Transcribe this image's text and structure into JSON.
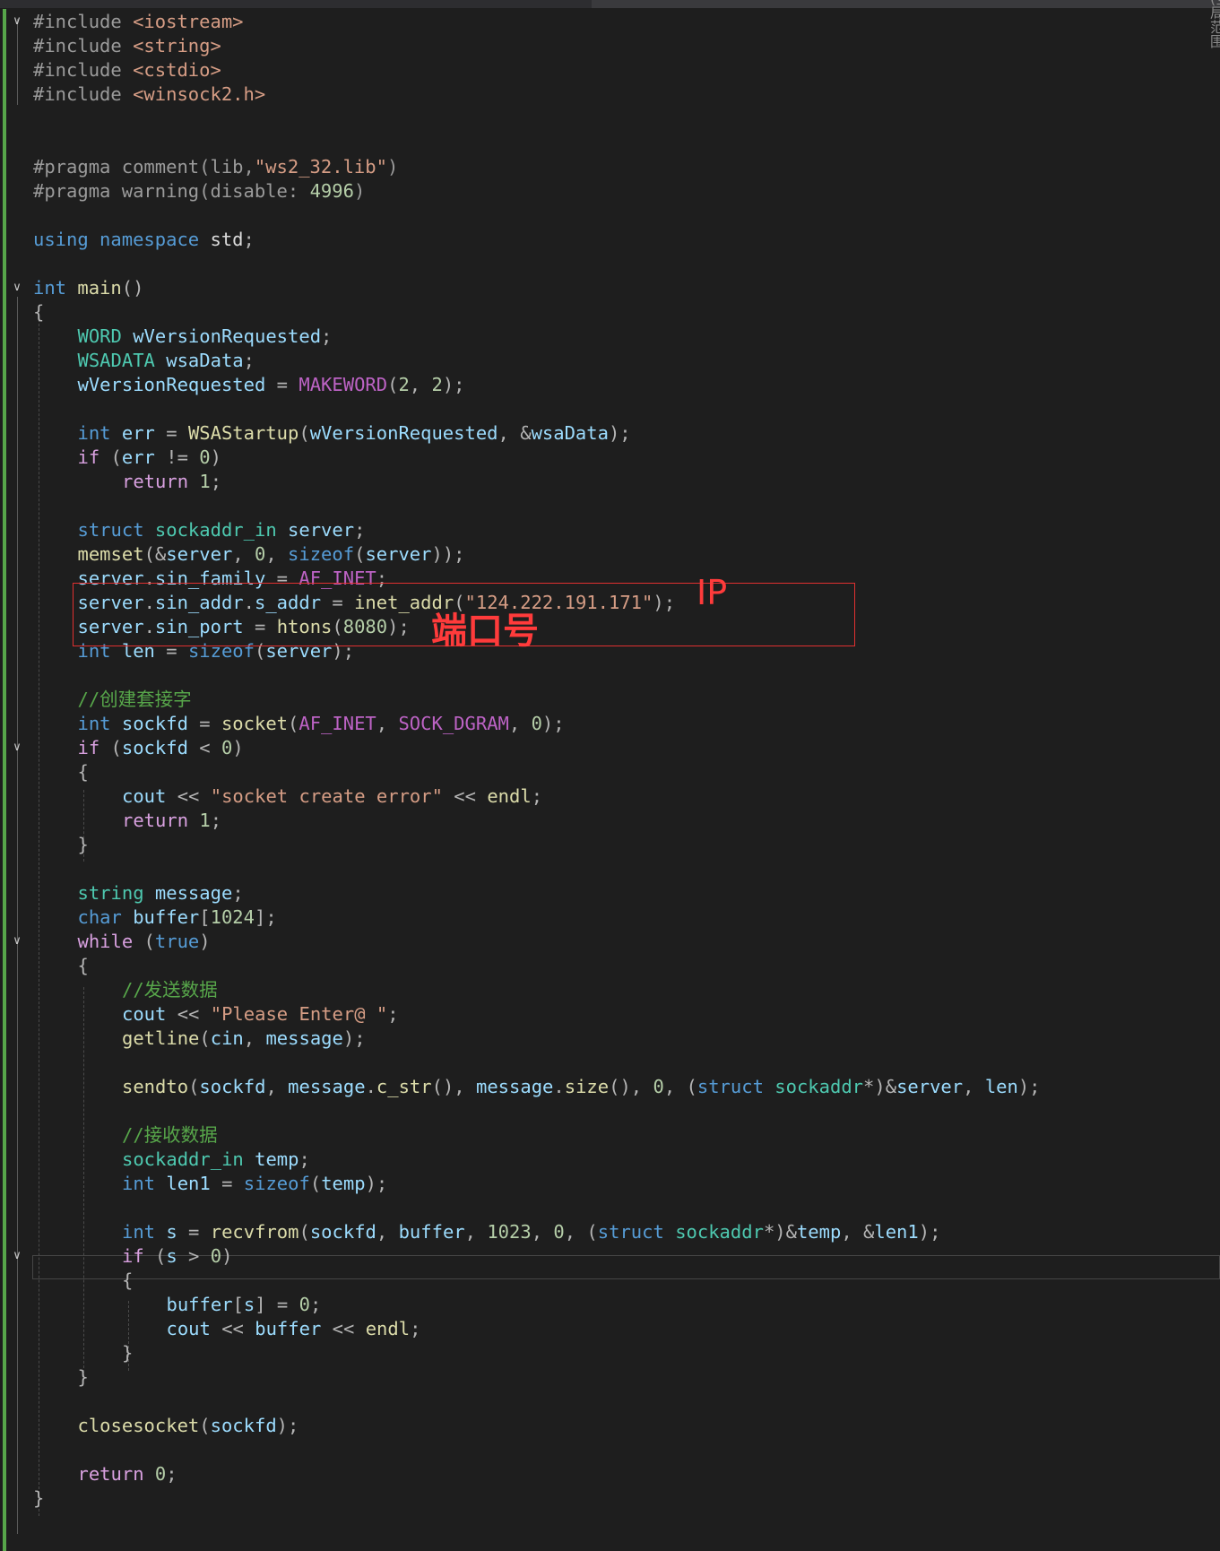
{
  "tab": {
    "title": "(全局范围)"
  },
  "annotations": {
    "ip_label": "IP",
    "port_label": "端口号"
  },
  "lines": [
    {
      "row": 0,
      "indent": 0,
      "fold": "v",
      "tokens": [
        [
          "pp",
          "#include "
        ],
        [
          "inc",
          "<iostream>"
        ]
      ]
    },
    {
      "row": 1,
      "indent": 0,
      "tokens": [
        [
          "pp",
          "#include "
        ],
        [
          "inc",
          "<string>"
        ]
      ]
    },
    {
      "row": 2,
      "indent": 0,
      "tokens": [
        [
          "pp",
          "#include "
        ],
        [
          "inc",
          "<cstdio>"
        ]
      ]
    },
    {
      "row": 3,
      "indent": 0,
      "tokens": [
        [
          "pp",
          "#include "
        ],
        [
          "inc",
          "<winsock2.h>"
        ]
      ]
    },
    {
      "row": 6,
      "indent": 0,
      "tokens": [
        [
          "pp",
          "#pragma comment(lib,"
        ],
        [
          "str",
          "\"ws2_32.lib\""
        ],
        [
          "pp",
          ")"
        ]
      ]
    },
    {
      "row": 7,
      "indent": 0,
      "tokens": [
        [
          "pp",
          "#pragma warning(disable: "
        ],
        [
          "num",
          "4996"
        ],
        [
          "pp",
          ")"
        ]
      ]
    },
    {
      "row": 9,
      "indent": 0,
      "tokens": [
        [
          "kw",
          "using namespace"
        ],
        [
          "",
          " std"
        ],
        [
          "pun",
          ";"
        ]
      ]
    },
    {
      "row": 11,
      "indent": 0,
      "fold": "v",
      "tokens": [
        [
          "kw",
          "int"
        ],
        [
          "",
          " "
        ],
        [
          "fn",
          "main"
        ],
        [
          "pun",
          "()"
        ]
      ]
    },
    {
      "row": 12,
      "indent": 0,
      "tokens": [
        [
          "pun",
          "{"
        ]
      ]
    },
    {
      "row": 13,
      "indent": 1,
      "tokens": [
        [
          "ty",
          "WORD"
        ],
        [
          "",
          " "
        ],
        [
          "var",
          "wVersionRequested"
        ],
        [
          "pun",
          ";"
        ]
      ]
    },
    {
      "row": 14,
      "indent": 1,
      "tokens": [
        [
          "ty",
          "WSADATA"
        ],
        [
          "",
          " "
        ],
        [
          "var",
          "wsaData"
        ],
        [
          "pun",
          ";"
        ]
      ]
    },
    {
      "row": 15,
      "indent": 1,
      "tokens": [
        [
          "var",
          "wVersionRequested"
        ],
        [
          "pun",
          " = "
        ],
        [
          "mac",
          "MAKEWORD"
        ],
        [
          "pun",
          "("
        ],
        [
          "num",
          "2"
        ],
        [
          "pun",
          ", "
        ],
        [
          "num",
          "2"
        ],
        [
          "pun",
          ");"
        ]
      ]
    },
    {
      "row": 17,
      "indent": 1,
      "tokens": [
        [
          "kw",
          "int"
        ],
        [
          "",
          " "
        ],
        [
          "var",
          "err"
        ],
        [
          "pun",
          " = "
        ],
        [
          "fn",
          "WSAStartup"
        ],
        [
          "pun",
          "("
        ],
        [
          "var",
          "wVersionRequested"
        ],
        [
          "pun",
          ", &"
        ],
        [
          "var",
          "wsaData"
        ],
        [
          "pun",
          ");"
        ]
      ]
    },
    {
      "row": 18,
      "indent": 1,
      "tokens": [
        [
          "ctl",
          "if"
        ],
        [
          "pun",
          " ("
        ],
        [
          "var",
          "err"
        ],
        [
          "pun",
          " != "
        ],
        [
          "num",
          "0"
        ],
        [
          "pun",
          ")"
        ]
      ]
    },
    {
      "row": 19,
      "indent": 2,
      "tokens": [
        [
          "ctl",
          "return"
        ],
        [
          "",
          " "
        ],
        [
          "num",
          "1"
        ],
        [
          "pun",
          ";"
        ]
      ]
    },
    {
      "row": 21,
      "indent": 1,
      "tokens": [
        [
          "kw",
          "struct"
        ],
        [
          "",
          " "
        ],
        [
          "ty",
          "sockaddr_in"
        ],
        [
          "",
          " "
        ],
        [
          "var",
          "server"
        ],
        [
          "pun",
          ";"
        ]
      ]
    },
    {
      "row": 22,
      "indent": 1,
      "tokens": [
        [
          "fn",
          "memset"
        ],
        [
          "pun",
          "(&"
        ],
        [
          "var",
          "server"
        ],
        [
          "pun",
          ", "
        ],
        [
          "num",
          "0"
        ],
        [
          "pun",
          ", "
        ],
        [
          "kw",
          "sizeof"
        ],
        [
          "pun",
          "("
        ],
        [
          "var",
          "server"
        ],
        [
          "pun",
          "));"
        ]
      ]
    },
    {
      "row": 23,
      "indent": 1,
      "tokens": [
        [
          "var",
          "server"
        ],
        [
          "pun",
          "."
        ],
        [
          "var",
          "sin_family"
        ],
        [
          "pun",
          " = "
        ],
        [
          "mac",
          "AF_INET"
        ],
        [
          "pun",
          ";"
        ]
      ]
    },
    {
      "row": 24,
      "indent": 1,
      "tokens": [
        [
          "var",
          "server"
        ],
        [
          "pun",
          "."
        ],
        [
          "var",
          "sin_addr"
        ],
        [
          "pun",
          "."
        ],
        [
          "var",
          "s_addr"
        ],
        [
          "pun",
          " = "
        ],
        [
          "fn",
          "inet_addr"
        ],
        [
          "pun",
          "("
        ],
        [
          "str",
          "\"124.222.191.171\""
        ],
        [
          "pun",
          ");"
        ]
      ]
    },
    {
      "row": 25,
      "indent": 1,
      "tokens": [
        [
          "var",
          "server"
        ],
        [
          "pun",
          "."
        ],
        [
          "var",
          "sin_port"
        ],
        [
          "pun",
          " = "
        ],
        [
          "fn",
          "htons"
        ],
        [
          "pun",
          "("
        ],
        [
          "num",
          "8080"
        ],
        [
          "pun",
          ");"
        ]
      ]
    },
    {
      "row": 26,
      "indent": 1,
      "tokens": [
        [
          "kw",
          "int"
        ],
        [
          "",
          " "
        ],
        [
          "var",
          "len"
        ],
        [
          "pun",
          " = "
        ],
        [
          "kw",
          "sizeof"
        ],
        [
          "pun",
          "("
        ],
        [
          "var",
          "server"
        ],
        [
          "pun",
          ");"
        ]
      ]
    },
    {
      "row": 28,
      "indent": 1,
      "tokens": [
        [
          "cmt",
          "//创建套接字"
        ]
      ]
    },
    {
      "row": 29,
      "indent": 1,
      "tokens": [
        [
          "kw",
          "int"
        ],
        [
          "",
          " "
        ],
        [
          "var",
          "sockfd"
        ],
        [
          "pun",
          " = "
        ],
        [
          "fn",
          "socket"
        ],
        [
          "pun",
          "("
        ],
        [
          "mac",
          "AF_INET"
        ],
        [
          "pun",
          ", "
        ],
        [
          "mac",
          "SOCK_DGRAM"
        ],
        [
          "pun",
          ", "
        ],
        [
          "num",
          "0"
        ],
        [
          "pun",
          ");"
        ]
      ]
    },
    {
      "row": 30,
      "indent": 1,
      "fold": "v",
      "tokens": [
        [
          "ctl",
          "if"
        ],
        [
          "pun",
          " ("
        ],
        [
          "var",
          "sockfd"
        ],
        [
          "pun",
          " < "
        ],
        [
          "num",
          "0"
        ],
        [
          "pun",
          ")"
        ]
      ]
    },
    {
      "row": 31,
      "indent": 1,
      "tokens": [
        [
          "pun",
          "{"
        ]
      ]
    },
    {
      "row": 32,
      "indent": 2,
      "tokens": [
        [
          "var",
          "cout"
        ],
        [
          "pun",
          " << "
        ],
        [
          "str",
          "\"socket create error\""
        ],
        [
          "pun",
          " << "
        ],
        [
          "fn",
          "endl"
        ],
        [
          "pun",
          ";"
        ]
      ]
    },
    {
      "row": 33,
      "indent": 2,
      "tokens": [
        [
          "ctl",
          "return"
        ],
        [
          "",
          " "
        ],
        [
          "num",
          "1"
        ],
        [
          "pun",
          ";"
        ]
      ]
    },
    {
      "row": 34,
      "indent": 1,
      "tokens": [
        [
          "pun",
          "}"
        ]
      ]
    },
    {
      "row": 36,
      "indent": 1,
      "tokens": [
        [
          "ty",
          "string"
        ],
        [
          "",
          " "
        ],
        [
          "var",
          "message"
        ],
        [
          "pun",
          ";"
        ]
      ]
    },
    {
      "row": 37,
      "indent": 1,
      "tokens": [
        [
          "kw",
          "char"
        ],
        [
          "",
          " "
        ],
        [
          "var",
          "buffer"
        ],
        [
          "pun",
          "["
        ],
        [
          "num",
          "1024"
        ],
        [
          "pun",
          "];"
        ]
      ]
    },
    {
      "row": 38,
      "indent": 1,
      "fold": "v",
      "tokens": [
        [
          "ctl",
          "while"
        ],
        [
          "pun",
          " ("
        ],
        [
          "kw",
          "true"
        ],
        [
          "pun",
          ")"
        ]
      ]
    },
    {
      "row": 39,
      "indent": 1,
      "tokens": [
        [
          "pun",
          "{"
        ]
      ]
    },
    {
      "row": 40,
      "indent": 2,
      "tokens": [
        [
          "cmt",
          "//发送数据"
        ]
      ]
    },
    {
      "row": 41,
      "indent": 2,
      "tokens": [
        [
          "var",
          "cout"
        ],
        [
          "pun",
          " << "
        ],
        [
          "str",
          "\"Please Enter@ \""
        ],
        [
          "pun",
          ";"
        ]
      ]
    },
    {
      "row": 42,
      "indent": 2,
      "tokens": [
        [
          "fn",
          "getline"
        ],
        [
          "pun",
          "("
        ],
        [
          "var",
          "cin"
        ],
        [
          "pun",
          ", "
        ],
        [
          "var",
          "message"
        ],
        [
          "pun",
          ");"
        ]
      ]
    },
    {
      "row": 44,
      "indent": 2,
      "tokens": [
        [
          "fn",
          "sendto"
        ],
        [
          "pun",
          "("
        ],
        [
          "var",
          "sockfd"
        ],
        [
          "pun",
          ", "
        ],
        [
          "var",
          "message"
        ],
        [
          "pun",
          "."
        ],
        [
          "fn",
          "c_str"
        ],
        [
          "pun",
          "(), "
        ],
        [
          "var",
          "message"
        ],
        [
          "pun",
          "."
        ],
        [
          "fn",
          "size"
        ],
        [
          "pun",
          "(), "
        ],
        [
          "num",
          "0"
        ],
        [
          "pun",
          ", ("
        ],
        [
          "kw",
          "struct"
        ],
        [
          "",
          " "
        ],
        [
          "ty",
          "sockaddr"
        ],
        [
          "pun",
          "*)&"
        ],
        [
          "var",
          "server"
        ],
        [
          "pun",
          ", "
        ],
        [
          "var",
          "len"
        ],
        [
          "pun",
          ");"
        ]
      ]
    },
    {
      "row": 46,
      "indent": 2,
      "tokens": [
        [
          "cmt",
          "//接收数据"
        ]
      ]
    },
    {
      "row": 47,
      "indent": 2,
      "tokens": [
        [
          "ty",
          "sockaddr_in"
        ],
        [
          "",
          " "
        ],
        [
          "var",
          "temp"
        ],
        [
          "pun",
          ";"
        ]
      ]
    },
    {
      "row": 48,
      "indent": 2,
      "tokens": [
        [
          "kw",
          "int"
        ],
        [
          "",
          " "
        ],
        [
          "var",
          "len1"
        ],
        [
          "pun",
          " = "
        ],
        [
          "kw",
          "sizeof"
        ],
        [
          "pun",
          "("
        ],
        [
          "var",
          "temp"
        ],
        [
          "pun",
          ");"
        ]
      ]
    },
    {
      "row": 50,
      "indent": 2,
      "tokens": [
        [
          "kw",
          "int"
        ],
        [
          "",
          " "
        ],
        [
          "var",
          "s"
        ],
        [
          "pun",
          " = "
        ],
        [
          "fn",
          "recvfrom"
        ],
        [
          "pun",
          "("
        ],
        [
          "var",
          "sockfd"
        ],
        [
          "pun",
          ", "
        ],
        [
          "var",
          "buffer"
        ],
        [
          "pun",
          ", "
        ],
        [
          "num",
          "1023"
        ],
        [
          "pun",
          ", "
        ],
        [
          "num",
          "0"
        ],
        [
          "pun",
          ", ("
        ],
        [
          "kw",
          "struct"
        ],
        [
          "",
          " "
        ],
        [
          "ty",
          "sockaddr"
        ],
        [
          "pun",
          "*)&"
        ],
        [
          "var",
          "temp"
        ],
        [
          "pun",
          ", &"
        ],
        [
          "var",
          "len1"
        ],
        [
          "pun",
          ");"
        ]
      ]
    },
    {
      "row": 51,
      "indent": 2,
      "fold": "v",
      "tokens": [
        [
          "ctl",
          "if"
        ],
        [
          "pun",
          " ("
        ],
        [
          "var",
          "s"
        ],
        [
          "pun",
          " > "
        ],
        [
          "num",
          "0"
        ],
        [
          "pun",
          ")"
        ]
      ]
    },
    {
      "row": 52,
      "indent": 2,
      "tokens": [
        [
          "pun",
          "{"
        ]
      ]
    },
    {
      "row": 53,
      "indent": 3,
      "tokens": [
        [
          "var",
          "buffer"
        ],
        [
          "pun",
          "["
        ],
        [
          "var",
          "s"
        ],
        [
          "pun",
          "] = "
        ],
        [
          "num",
          "0"
        ],
        [
          "pun",
          ";"
        ]
      ]
    },
    {
      "row": 54,
      "indent": 3,
      "tokens": [
        [
          "var",
          "cout"
        ],
        [
          "pun",
          " << "
        ],
        [
          "var",
          "buffer"
        ],
        [
          "pun",
          " << "
        ],
        [
          "fn",
          "endl"
        ],
        [
          "pun",
          ";"
        ]
      ]
    },
    {
      "row": 55,
      "indent": 2,
      "tokens": [
        [
          "pun",
          "}"
        ]
      ]
    },
    {
      "row": 56,
      "indent": 1,
      "tokens": [
        [
          "pun",
          "}"
        ]
      ]
    },
    {
      "row": 58,
      "indent": 1,
      "tokens": [
        [
          "fn",
          "closesocket"
        ],
        [
          "pun",
          "("
        ],
        [
          "var",
          "sockfd"
        ],
        [
          "pun",
          ");"
        ]
      ]
    },
    {
      "row": 60,
      "indent": 1,
      "tokens": [
        [
          "ctl",
          "return"
        ],
        [
          "",
          " "
        ],
        [
          "num",
          "0"
        ],
        [
          "pun",
          ";"
        ]
      ]
    },
    {
      "row": 61,
      "indent": 0,
      "tokens": [
        [
          "pun",
          "}"
        ]
      ]
    }
  ]
}
